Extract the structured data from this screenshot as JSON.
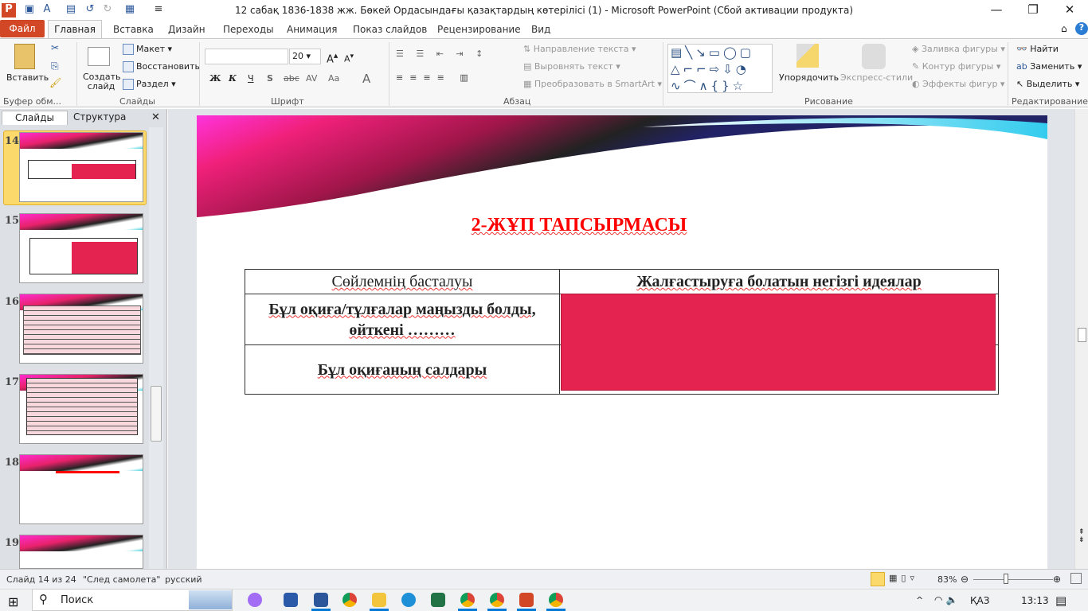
{
  "window": {
    "title": "12 сабақ 1836-1838 жж. Бөкей Ордасындағы қазақтардың көтерілісі (1)  -  Microsoft PowerPoint (Сбой активации продукта)"
  },
  "tabs": [
    "Файл",
    "Главная",
    "Вставка",
    "Дизайн",
    "Переходы",
    "Анимация",
    "Показ слайдов",
    "Рецензирование",
    "Вид"
  ],
  "ribbon": {
    "clipboard": {
      "paste": "Вставить",
      "group": "Буфер обм..."
    },
    "slides": {
      "new_slide": "Создать слайд",
      "layout": "Макет",
      "reset": "Восстановить",
      "section": "Раздел",
      "group": "Слайды"
    },
    "font": {
      "font_name": "",
      "font_size": "20",
      "bold": "Ж",
      "italic": "К",
      "underline": "Ч",
      "shadow": "S",
      "strike": "abc",
      "spacing": "AV",
      "case": "Aa",
      "color": "A",
      "group": "Шрифт"
    },
    "paragraph": {
      "text_direction": "Направление текста",
      "align_text": "Выровнять текст",
      "smartart": "Преобразовать в SmartArt",
      "group": "Абзац"
    },
    "drawing": {
      "arrange": "Упорядочить",
      "quick_styles": "Экспресс-стили",
      "fill": "Заливка фигуры",
      "outline": "Контур фигуры",
      "effects": "Эффекты фигур",
      "group": "Рисование"
    },
    "editing": {
      "find": "Найти",
      "replace": "Заменить",
      "select": "Выделить",
      "group": "Редактирование"
    }
  },
  "panel": {
    "tabs": [
      "Слайды",
      "Структура"
    ],
    "slides": [
      "14",
      "15",
      "16",
      "17",
      "18",
      "19"
    ],
    "selected": "14"
  },
  "slide": {
    "title": "2-ЖҰП ТАПСЫРМАСЫ",
    "table": {
      "headers": [
        "Сөйлемнің басталуы",
        "Жалғастыруға  болатын негізгі идеялар"
      ],
      "rows": [
        [
          "Бұл  оқиға/тұлғалар  маңызды болды, өйткені ………",
          ""
        ],
        [
          "Бұл оқиғаның салдары",
          ""
        ]
      ]
    },
    "accent_color": "#e52350",
    "title_color": "#ff0000"
  },
  "status": {
    "slide": "Слайд 14 из 24",
    "theme": "\"След самолета\"",
    "language": "русский",
    "zoom": "83%",
    "zoom_percent": 83
  },
  "taskbar": {
    "search": "Поиск",
    "lang": "ҚАЗ",
    "time": "13:13"
  }
}
